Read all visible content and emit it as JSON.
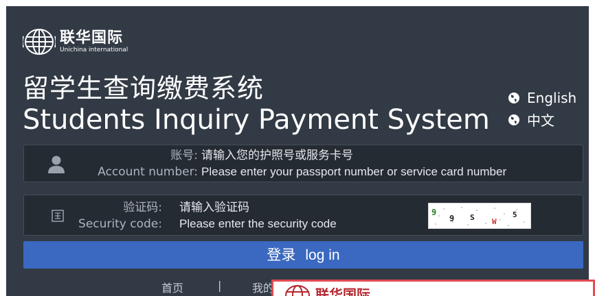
{
  "header": {
    "logo_cn": "联华国际",
    "logo_en": "Unichina international",
    "title_cn": "留学生查询缴费系统",
    "title_en": "Students Inquiry Payment System"
  },
  "languages": [
    {
      "label": "English",
      "icon": "globe-icon"
    },
    {
      "label": "中文",
      "icon": "globe-icon"
    }
  ],
  "account_field": {
    "icon": "user-icon",
    "label_cn": "账号:",
    "label_en": "Account number:",
    "placeholder_cn": "请输入您的护照号或服务卡号",
    "placeholder_en": "Please enter your passport number or service card number"
  },
  "security_field": {
    "icon": "captcha-icon",
    "label_cn": "验证码:",
    "label_en": "Security code:",
    "placeholder_cn": "请输入验证码",
    "placeholder_en": "Please enter the security code",
    "captcha_text": "9 9 S W 5"
  },
  "login": {
    "label_cn": "登录",
    "label_en": "log in"
  },
  "footer": {
    "home": "首页",
    "separator": "|",
    "my": "我的"
  },
  "overlay": {
    "logo_cn": "联华国际"
  },
  "colors": {
    "panel_bg": "#323a45",
    "field_bg": "#252b33",
    "button_bg": "#3b69c1",
    "overlay_border": "#e24b55"
  }
}
